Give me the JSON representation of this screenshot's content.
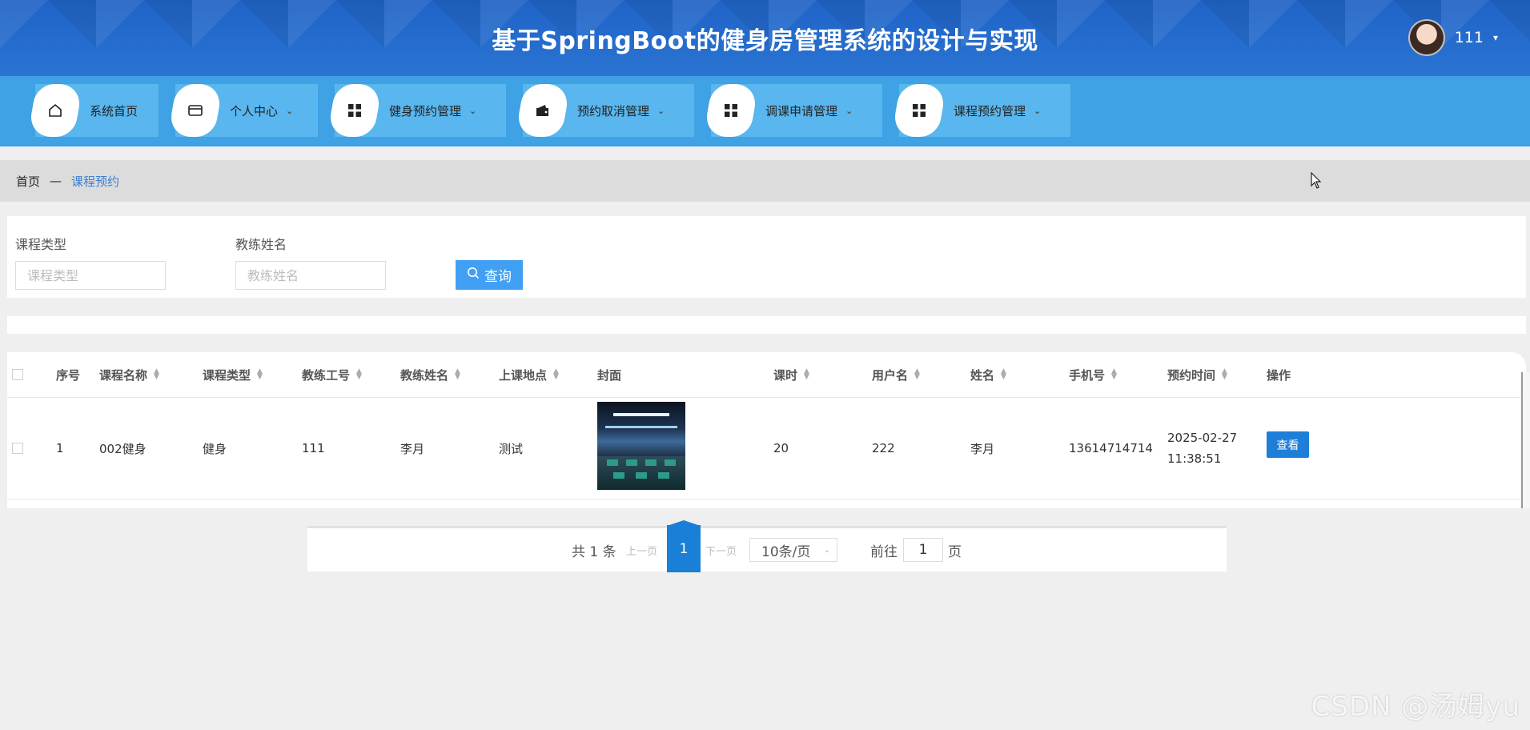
{
  "header": {
    "title": "基于SpringBoot的健身房管理系统的设计与实现",
    "user_name": "111",
    "user_caret": "▾"
  },
  "nav": {
    "items": [
      {
        "label": "系统首页",
        "icon": "home-icon",
        "has_dropdown": false
      },
      {
        "label": "个人中心",
        "icon": "card-icon",
        "has_dropdown": true
      },
      {
        "label": "健身预约管理",
        "icon": "grid-icon",
        "has_dropdown": true
      },
      {
        "label": "预约取消管理",
        "icon": "wallet-icon",
        "has_dropdown": true
      },
      {
        "label": "调课申请管理",
        "icon": "grid-icon",
        "has_dropdown": true
      },
      {
        "label": "课程预约管理",
        "icon": "grid-icon",
        "has_dropdown": true
      }
    ],
    "chevron": "⌄"
  },
  "breadcrumb": {
    "home": "首页",
    "separator": "—",
    "current": "课程预约"
  },
  "search": {
    "course_type_label": "课程类型",
    "course_type_placeholder": "课程类型",
    "coach_name_label": "教练姓名",
    "coach_name_placeholder": "教练姓名",
    "search_button": "查询"
  },
  "table": {
    "columns": [
      "序号",
      "课程名称",
      "课程类型",
      "教练工号",
      "教练姓名",
      "上课地点",
      "封面",
      "课时",
      "用户名",
      "姓名",
      "手机号",
      "预约时间",
      "操作"
    ],
    "sortable": [
      false,
      true,
      true,
      true,
      true,
      true,
      false,
      true,
      true,
      true,
      true,
      true,
      false
    ],
    "rows": [
      {
        "index": "1",
        "course_name": "002健身",
        "course_type": "健身",
        "coach_id": "111",
        "coach_name": "李月",
        "location": "测试",
        "hours": "20",
        "username": "222",
        "name": "李月",
        "phone": "13614714714",
        "booking_time": "2025-02-27 11:38:51",
        "action": "查看"
      }
    ]
  },
  "pagination": {
    "total": "共 1 条",
    "prev": "上一页",
    "current_page": "1",
    "next": "下一页",
    "page_size": "10条/页",
    "goto_label": "前往",
    "goto_value": "1",
    "page_suffix": "页"
  },
  "watermark": "CSDN @汤姆yu",
  "colors": {
    "header_blue": "#2a74d3",
    "nav_blue": "#3ea2e4",
    "primary_button": "#1f7fd8",
    "search_button": "#41a0f4",
    "link_blue": "#3a7fd0"
  }
}
